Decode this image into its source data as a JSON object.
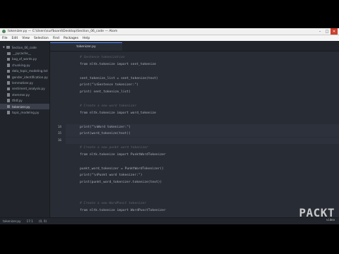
{
  "window": {
    "title": "tokenizer.py — C:\\Users\\surfboard\\Desktop\\Section_06_code — Atom"
  },
  "menu": [
    "File",
    "Edit",
    "View",
    "Selection",
    "Find",
    "Packages",
    "Help"
  ],
  "sidebar": {
    "root": "Section_06_code",
    "items": [
      "__pycache__",
      "bag_of_words.py",
      "chunking.py",
      "data_topic_modeling.txt",
      "gender_identification.py",
      "lemmatizer.py",
      "sentiment_analysis.py",
      "stemmer.py",
      "tfidf.py",
      "tokenizer.py",
      "topic_modeling.py"
    ],
    "selected_index": 9
  },
  "tab": {
    "label": "tokenizer.py"
  },
  "code": [
    {
      "n": "",
      "text": "# Sentence tokenization",
      "kind": "comment"
    },
    {
      "n": "",
      "text": "from nltk.tokenize import sent_tokenize",
      "kind": "code"
    },
    {
      "n": "",
      "text": "",
      "kind": "code"
    },
    {
      "n": "",
      "text": "sent_tokenize_list = sent_tokenize(text)",
      "kind": "code"
    },
    {
      "n": "",
      "text": "print(\"\\nSentence tokenizer:\")",
      "kind": "code"
    },
    {
      "n": "",
      "text": "print( sent_tokenize_list)",
      "kind": "code"
    },
    {
      "n": "",
      "text": "",
      "kind": "code"
    },
    {
      "n": "",
      "text": "# Create a new word tokenizer",
      "kind": "comment"
    },
    {
      "n": "",
      "text": "from nltk.tokenize import word_tokenize",
      "kind": "code"
    },
    {
      "n": "",
      "text": "",
      "kind": "code"
    },
    {
      "n": "14",
      "text": "print(\"\\nWord tokenizer:\")",
      "kind": "code"
    },
    {
      "n": "15",
      "text": "print(word_tokenize(text))",
      "kind": "code"
    },
    {
      "n": "16",
      "text": "",
      "kind": "code"
    },
    {
      "n": "",
      "text": "# Create a new punkt word tokenizer",
      "kind": "comment"
    },
    {
      "n": "",
      "text": "from nltk.tokenize import PunktWordTokenizer",
      "kind": "code"
    },
    {
      "n": "",
      "text": "",
      "kind": "code"
    },
    {
      "n": "",
      "text": "punkt_word_tokenizer = PunktWordTokenizer()",
      "kind": "code"
    },
    {
      "n": "",
      "text": "print(\"\\nPunkt word tokenizer:\")",
      "kind": "code"
    },
    {
      "n": "",
      "text": "print(punkt_word_tokenizer.tokenize(text))",
      "kind": "code"
    },
    {
      "n": "",
      "text": "",
      "kind": "code"
    },
    {
      "n": "",
      "text": "",
      "kind": "code"
    },
    {
      "n": "",
      "text": "# Create a new WordPunct tokenizer",
      "kind": "comment"
    },
    {
      "n": "",
      "text": "from nltk.tokenize import WordPunctTokenizer",
      "kind": "code"
    }
  ],
  "highlight_lines": [
    10,
    11,
    12
  ],
  "status": {
    "file": "tokenizer.py",
    "position": "17:1",
    "selection": "(0, 0)"
  },
  "logo": {
    "word": "PACKT",
    "tagline": "video"
  }
}
